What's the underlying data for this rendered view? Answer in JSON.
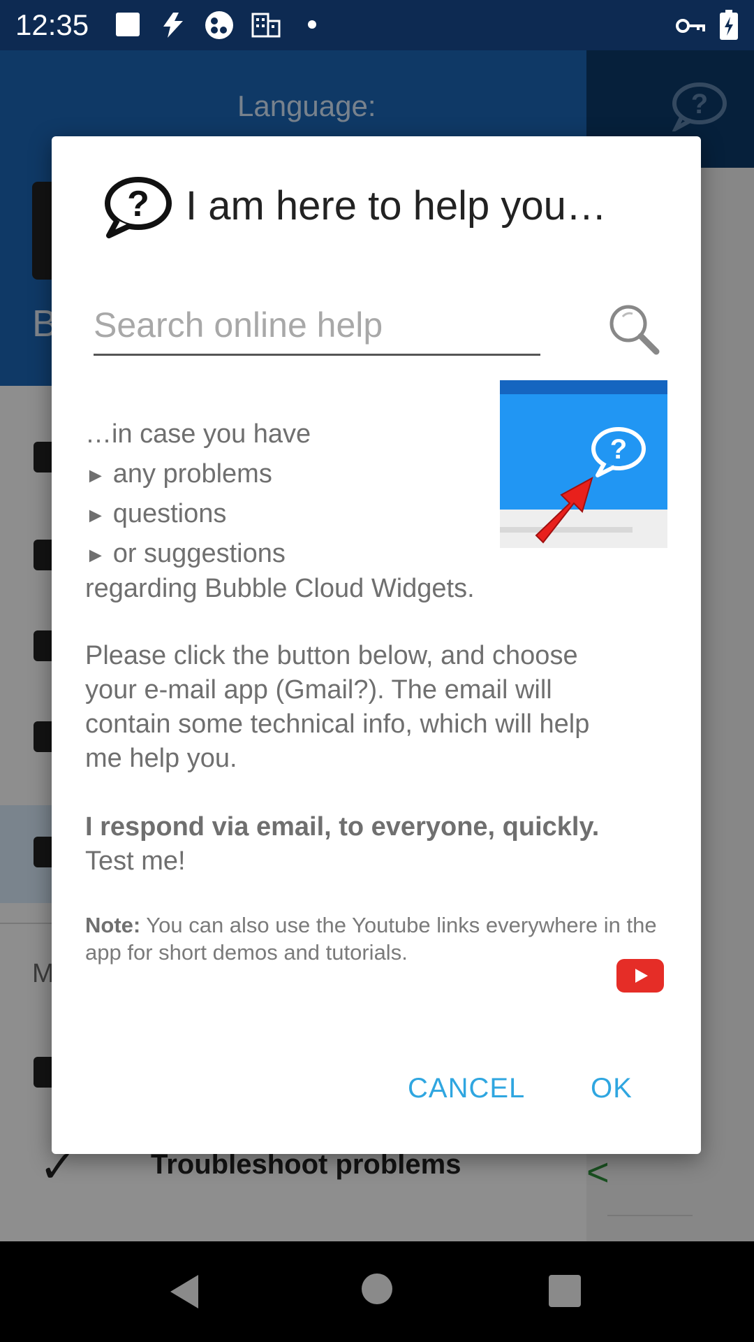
{
  "status_bar": {
    "time": "12:35",
    "icons": [
      "square-notification-icon",
      "bolt-icon",
      "app-circle-icon",
      "building-icon",
      "dot-icon",
      "vpn-key-icon",
      "battery-charging-icon"
    ]
  },
  "background": {
    "language_label": "Language:",
    "letter_b": "B",
    "section_letter": "M",
    "troubleshoot_label": "Troubleshoot problems"
  },
  "dialog": {
    "title": "I am here to help you…",
    "search_placeholder": "Search online help",
    "intro": "…in case you have",
    "bullets": [
      "any problems",
      "questions",
      "or suggestions"
    ],
    "bullet_glyph": "►",
    "regarding": "regarding Bubble Cloud Widgets.",
    "instructions": [
      "Please click the button below, and choose",
      "your e-mail app (Gmail?). The email will",
      "contain some technical info, which will help",
      "me help you."
    ],
    "respond_bold": "I respond via email, to everyone, quickly.",
    "test_me": "Test me!",
    "note_label": "Note:",
    "note_text": " You can also use the Youtube links everywhere in the app for short demos and tutorials.",
    "cancel_label": "CANCEL",
    "ok_label": "OK"
  },
  "colors": {
    "accent": "#2fa6e0",
    "header_blue": "#1a63b0",
    "promo_blue": "#2196f3",
    "youtube_red": "#e52d27"
  }
}
